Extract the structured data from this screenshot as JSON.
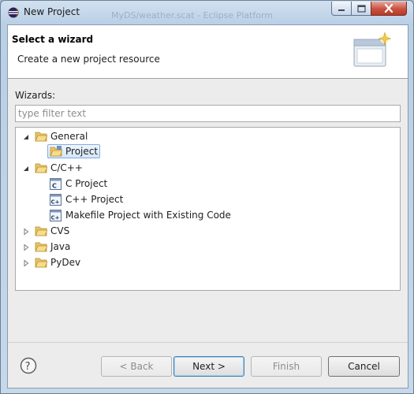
{
  "window": {
    "title": "New Project",
    "background_title": "MyDS/weather.scat - Eclipse Platform",
    "controls": {
      "minimize_icon": "minimize-icon",
      "maximize_icon": "maximize-icon",
      "close_icon": "close-icon"
    }
  },
  "header": {
    "title": "Select a wizard",
    "description": "Create a new project resource",
    "graphic_icon": "new-wizard-banner-icon"
  },
  "wizards": {
    "label": "Wizards:",
    "filter_value": "",
    "filter_placeholder": "type filter text"
  },
  "tree": {
    "general": {
      "label": "General",
      "expanded": true
    },
    "project": {
      "label": "Project",
      "selected": true
    },
    "cpp": {
      "label": "C/C++",
      "expanded": true
    },
    "c_project": {
      "label": "C Project"
    },
    "cpp_project": {
      "label": "C++ Project"
    },
    "makefile_project": {
      "label": "Makefile Project with Existing Code"
    },
    "cvs": {
      "label": "CVS",
      "expanded": false
    },
    "java": {
      "label": "Java",
      "expanded": false
    },
    "pydev": {
      "label": "PyDev",
      "expanded": false
    }
  },
  "buttons": {
    "help_icon": "help-icon",
    "back": "< Back",
    "next": "Next >",
    "finish": "Finish",
    "cancel": "Cancel"
  },
  "colors": {
    "title_bar": "#c6d8ea",
    "close_button": "#c85140",
    "selection": "#d5e6f9",
    "folder": "#e8c468"
  }
}
